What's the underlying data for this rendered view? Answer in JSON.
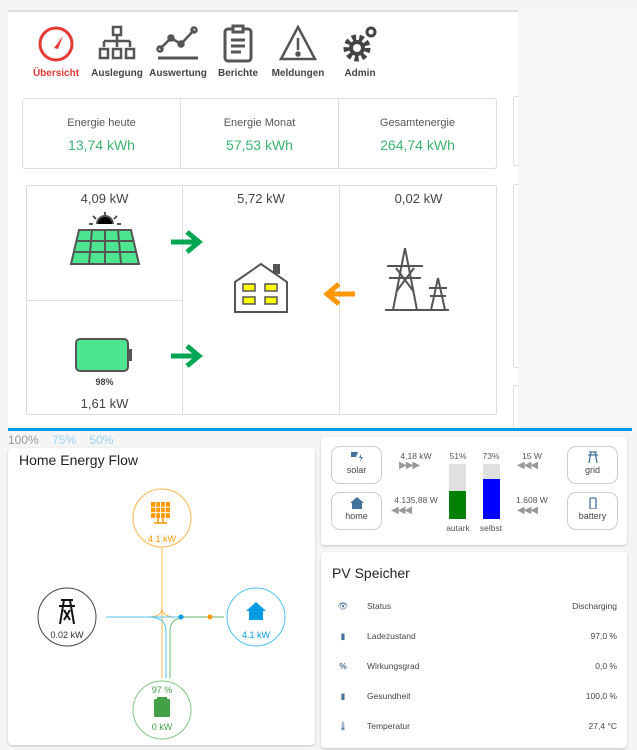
{
  "nav": [
    {
      "label": "Übersicht",
      "icon": "gauge-icon",
      "active": true
    },
    {
      "label": "Auslegung",
      "icon": "sitemap-icon"
    },
    {
      "label": "Auswertung",
      "icon": "line-chart-icon"
    },
    {
      "label": "Berichte",
      "icon": "clipboard-icon"
    },
    {
      "label": "Meldungen",
      "icon": "warning-icon"
    },
    {
      "label": "Admin",
      "icon": "gears-icon"
    }
  ],
  "stats": [
    {
      "label": "Energie heute",
      "value": "13,74 kWh"
    },
    {
      "label": "Energie Monat",
      "value": "57,53 kWh"
    },
    {
      "label": "Gesamtenergie",
      "value": "264,74 kWh"
    }
  ],
  "flow": {
    "pv": "4,09 kW",
    "house": "5,72 kW",
    "grid": "0,02 kW",
    "battery_pct": "98%",
    "battery": "1,61 kW",
    "battery_fill": 0.98
  },
  "pcts": [
    "100%",
    "75%",
    "50%"
  ],
  "hef": {
    "title": "Home Energy Flow",
    "solar": "4.1 kW",
    "grid": "0.02 kW",
    "home": "4.1 kW",
    "battery_pct": "97 %",
    "battery": "0 kW"
  },
  "power": {
    "solar_label": "solar",
    "home_label": "home",
    "grid_label": "grid",
    "battery_label": "battery",
    "solar_val": "4,18 kW",
    "home_val": "4.135,88 W",
    "grid_val": "15 W",
    "battery_val": "1.608 W",
    "autark_pct": "51%",
    "selbst_pct": "73%",
    "autark_label": "autark",
    "selbst_label": "selbst",
    "autark": 51,
    "selbst": 73
  },
  "speicher": {
    "title": "PV Speicher",
    "rows": [
      {
        "icon": "eye-icon",
        "label": "Status",
        "value": "Discharging"
      },
      {
        "icon": "battery-icon",
        "label": "Ladezustand",
        "value": "97,0 %"
      },
      {
        "icon": "percent-icon",
        "label": "Wirkungsgrad",
        "value": "0,0 %"
      },
      {
        "icon": "battery-heart-icon",
        "label": "Gesundheit",
        "value": "100,0 %"
      },
      {
        "icon": "thermometer-icon",
        "label": "Temperatur",
        "value": "27,4 °C"
      }
    ]
  },
  "colors": {
    "green": "#3cb371",
    "arrow_green": "#00a651",
    "orange": "#ff9800",
    "blue": "#039be5",
    "solar": "#ff9800",
    "autark": "#008000",
    "selbst": "#0000ff"
  }
}
